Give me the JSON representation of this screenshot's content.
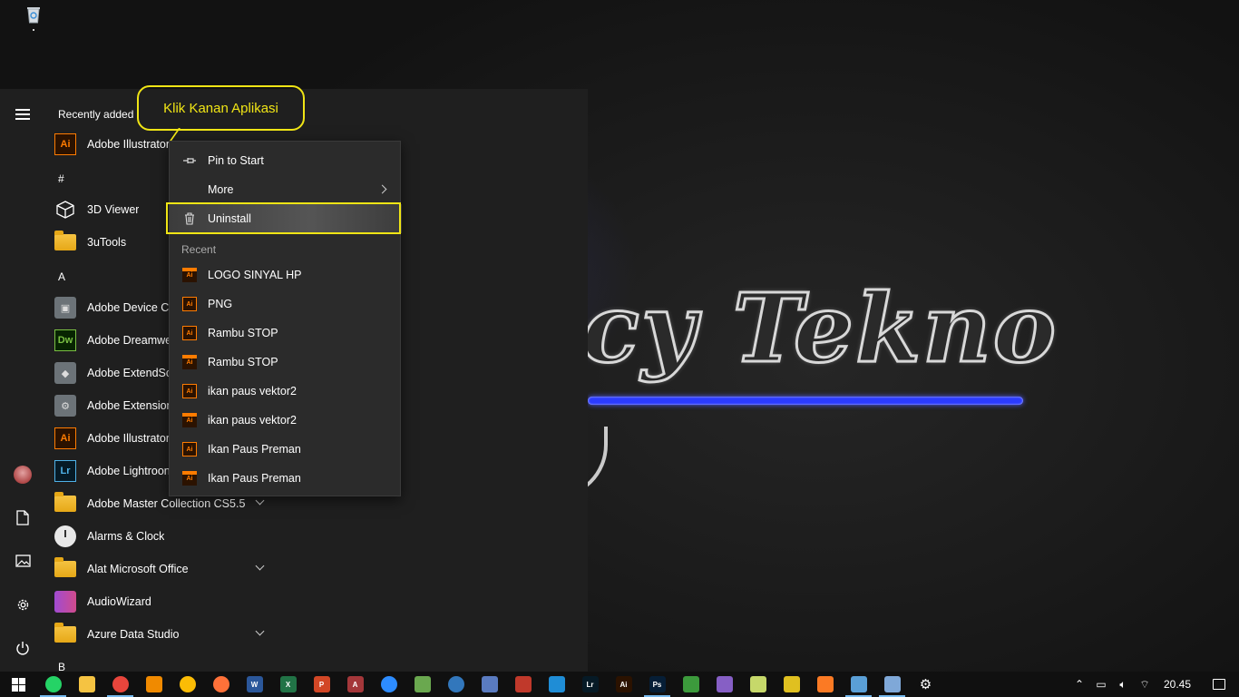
{
  "callout": {
    "text": "Klik Kanan Aplikasi"
  },
  "wallpaper": {
    "text": "icy Tekno"
  },
  "start_menu": {
    "recently_added_label": "Recently added",
    "recent_app": {
      "label": "Adobe Illustrator",
      "icon": "Ai"
    },
    "sections": [
      {
        "letter": "#",
        "items": [
          {
            "label": "3D Viewer",
            "icon": "cube-icon",
            "expandable": false
          },
          {
            "label": "3uTools",
            "icon": "folder-icon",
            "expandable": false
          }
        ]
      },
      {
        "letter": "A",
        "items": [
          {
            "label": "Adobe Device Ce",
            "icon": "adobe-device-central-icon",
            "expandable": false
          },
          {
            "label": "Adobe Dreamwe",
            "icon": "Dw",
            "expandable": false
          },
          {
            "label": "Adobe ExtendScr",
            "icon": "adobe-extendscript-icon",
            "expandable": false
          },
          {
            "label": "Adobe Extension",
            "icon": "adobe-extension-manager-icon",
            "expandable": false
          },
          {
            "label": "Adobe Illustrator",
            "icon": "Ai",
            "expandable": false
          },
          {
            "label": "Adobe Lightroon",
            "icon": "Lr",
            "expandable": false
          },
          {
            "label": "Adobe Master Collection CS5.5",
            "icon": "folder-icon",
            "expandable": true
          },
          {
            "label": "Alarms & Clock",
            "icon": "clock-icon",
            "expandable": false
          },
          {
            "label": "Alat Microsoft Office",
            "icon": "folder-icon",
            "expandable": true
          },
          {
            "label": "AudioWizard",
            "icon": "audiowizard-icon",
            "expandable": false
          },
          {
            "label": "Azure Data Studio",
            "icon": "folder-icon",
            "expandable": true
          }
        ]
      },
      {
        "letter": "B",
        "items": []
      }
    ]
  },
  "context_menu": {
    "pin_to_start": "Pin to Start",
    "more": "More",
    "uninstall": "Uninstall",
    "recent_header": "Recent",
    "recent_files": [
      "LOGO SINYAL HP",
      "PNG",
      "Rambu STOP",
      "Rambu STOP",
      "ikan paus vektor2",
      "ikan paus vektor2",
      "Ikan Paus Preman",
      "Ikan Paus Preman"
    ]
  },
  "taskbar": {
    "apps": [
      {
        "name": "whatsapp",
        "color": "#25d366",
        "text": ""
      },
      {
        "name": "file-explorer",
        "color": "#f5c342",
        "text": ""
      },
      {
        "name": "chrome",
        "color": "#e8453c",
        "text": ""
      },
      {
        "name": "vlc",
        "color": "#f08a00",
        "text": ""
      },
      {
        "name": "chrome-2",
        "color": "#fbbc05",
        "text": ""
      },
      {
        "name": "firefox",
        "color": "#ff7139",
        "text": ""
      },
      {
        "name": "word",
        "color": "#2b579a",
        "text": "W"
      },
      {
        "name": "excel",
        "color": "#217346",
        "text": "X"
      },
      {
        "name": "powerpoint",
        "color": "#d24726",
        "text": "P"
      },
      {
        "name": "access",
        "color": "#a4373a",
        "text": "A"
      },
      {
        "name": "zoom",
        "color": "#2d8cff",
        "text": ""
      },
      {
        "name": "app-11",
        "color": "#6aa84f",
        "text": ""
      },
      {
        "name": "edge",
        "color": "#3277bc",
        "text": ""
      },
      {
        "name": "app-13",
        "color": "#5a7bc0",
        "text": ""
      },
      {
        "name": "app-14",
        "color": "#c0392b",
        "text": ""
      },
      {
        "name": "camera",
        "color": "#1f8dd6",
        "text": ""
      },
      {
        "name": "lightroom",
        "color": "#061a26",
        "text": "Lr"
      },
      {
        "name": "illustrator",
        "color": "#2b1200",
        "text": "Ai"
      },
      {
        "name": "photoshop",
        "color": "#061e36",
        "text": "Ps"
      },
      {
        "name": "app-19",
        "color": "#3c9a3c",
        "text": ""
      },
      {
        "name": "visual-studio",
        "color": "#865fc5",
        "text": ""
      },
      {
        "name": "notepad",
        "color": "#c6d86a",
        "text": ""
      },
      {
        "name": "app-22",
        "color": "#e0c020",
        "text": ""
      },
      {
        "name": "xampp",
        "color": "#fb7a24",
        "text": ""
      },
      {
        "name": "virtualbox",
        "color": "#5a9fd6",
        "text": ""
      },
      {
        "name": "paint",
        "color": "#7fa8d8",
        "text": ""
      },
      {
        "name": "settings",
        "color": "#101010",
        "text": "⚙"
      }
    ],
    "clock": "20.45"
  }
}
